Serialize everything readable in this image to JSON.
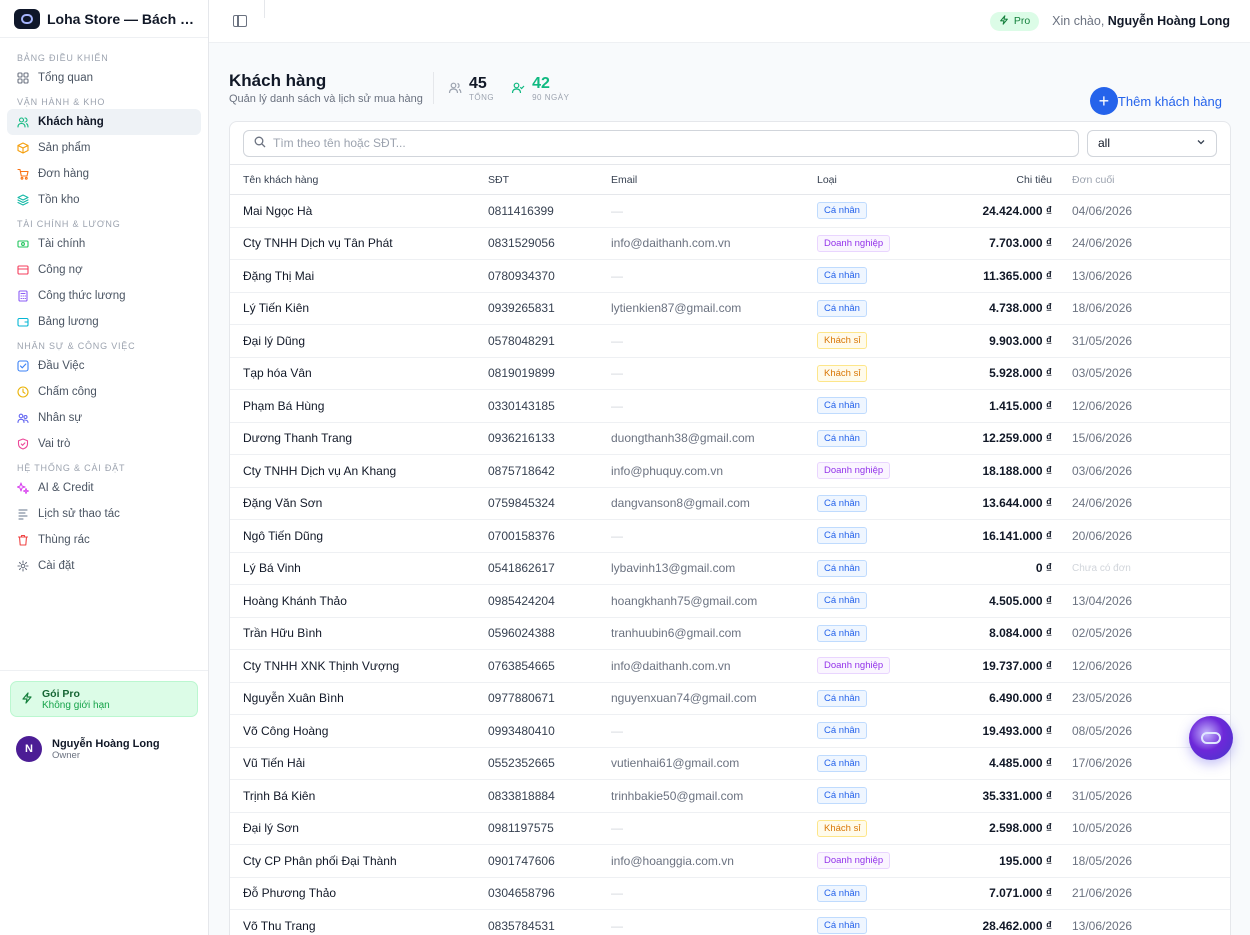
{
  "app": {
    "title": "Loha Store — Bách hóa ..."
  },
  "sidebar": {
    "groups": [
      {
        "label": "Bảng điều khiển",
        "items": [
          {
            "label": "Tổng quan",
            "icon": "grid-icon"
          }
        ]
      },
      {
        "label": "Vận hành & kho",
        "items": [
          {
            "label": "Khách hàng",
            "icon": "users-icon",
            "active": true
          },
          {
            "label": "Sản phẩm",
            "icon": "box-icon"
          },
          {
            "label": "Đơn hàng",
            "icon": "cart-icon"
          },
          {
            "label": "Tồn kho",
            "icon": "layers-icon"
          }
        ]
      },
      {
        "label": "Tài chính & lương",
        "items": [
          {
            "label": "Tài chính",
            "icon": "cash-icon"
          },
          {
            "label": "Công nợ",
            "icon": "debt-icon"
          },
          {
            "label": "Công thức lương",
            "icon": "calculator-icon"
          },
          {
            "label": "Bảng lương",
            "icon": "wallet-icon"
          }
        ]
      },
      {
        "label": "Nhân sự & công việc",
        "items": [
          {
            "label": "Đầu Việc",
            "icon": "checkbox-icon"
          },
          {
            "label": "Chấm công",
            "icon": "clock-icon"
          },
          {
            "label": "Nhân sự",
            "icon": "user-group-icon"
          },
          {
            "label": "Vai trò",
            "icon": "shield-icon"
          }
        ]
      },
      {
        "label": "Hệ thống & cài đặt",
        "items": [
          {
            "label": "AI & Credit",
            "icon": "sparkle-icon"
          },
          {
            "label": "Lịch sử thao tác",
            "icon": "history-icon"
          },
          {
            "label": "Thùng rác",
            "icon": "trash-icon"
          },
          {
            "label": "Cài đặt",
            "icon": "gear-icon"
          }
        ]
      }
    ],
    "plan": {
      "title": "Gói Pro",
      "subtitle": "Không giới hạn"
    },
    "user": {
      "initial": "N",
      "name": "Nguyễn Hoàng Long",
      "role": "Owner"
    }
  },
  "topbar": {
    "badge": "Pro",
    "greeting_prefix": "Xin chào,",
    "greeting_name": "Nguyễn Hoàng Long"
  },
  "page": {
    "title": "Khách hàng",
    "subtitle": "Quản lý danh sách và lịch sử mua hàng",
    "stats": [
      {
        "value": "45",
        "label": "Tổng"
      },
      {
        "value": "42",
        "label": "90 ngày"
      }
    ],
    "add_button": "Thêm khách hàng"
  },
  "filters": {
    "search_placeholder": "Tìm theo tên hoặc SĐT...",
    "type_select": "all"
  },
  "table": {
    "columns": [
      "Tên khách hàng",
      "SĐT",
      "Email",
      "Loại",
      "Chi tiêu",
      "Đơn cuối"
    ],
    "empty_email": "—",
    "rows": [
      {
        "name": "Mai Ngọc Hà",
        "phone": "0811416399",
        "email": "",
        "type": "Cá nhân",
        "kind": "personal",
        "spend": "24.424.000 ₫",
        "last": "04/06/2026"
      },
      {
        "name": "Cty TNHH Dịch vụ Tân Phát",
        "phone": "0831529056",
        "email": "info@daithanh.com.vn",
        "type": "Doanh nghiệp",
        "kind": "business",
        "spend": "7.703.000 ₫",
        "last": "24/06/2026"
      },
      {
        "name": "Đặng Thị Mai",
        "phone": "0780934370",
        "email": "",
        "type": "Cá nhân",
        "kind": "personal",
        "spend": "11.365.000 ₫",
        "last": "13/06/2026"
      },
      {
        "name": "Lý Tiến Kiên",
        "phone": "0939265831",
        "email": "lytienkien87@gmail.com",
        "type": "Cá nhân",
        "kind": "personal",
        "spend": "4.738.000 ₫",
        "last": "18/06/2026"
      },
      {
        "name": "Đại lý Dũng",
        "phone": "0578048291",
        "email": "",
        "type": "Khách sỉ",
        "kind": "wholesale",
        "spend": "9.903.000 ₫",
        "last": "31/05/2026"
      },
      {
        "name": "Tạp hóa Vân",
        "phone": "0819019899",
        "email": "",
        "type": "Khách sỉ",
        "kind": "wholesale",
        "spend": "5.928.000 ₫",
        "last": "03/05/2026"
      },
      {
        "name": "Phạm Bá Hùng",
        "phone": "0330143185",
        "email": "",
        "type": "Cá nhân",
        "kind": "personal",
        "spend": "1.415.000 ₫",
        "last": "12/06/2026"
      },
      {
        "name": "Dương Thanh Trang",
        "phone": "0936216133",
        "email": "duongthanh38@gmail.com",
        "type": "Cá nhân",
        "kind": "personal",
        "spend": "12.259.000 ₫",
        "last": "15/06/2026"
      },
      {
        "name": "Cty TNHH Dịch vụ An Khang",
        "phone": "0875718642",
        "email": "info@phuquy.com.vn",
        "type": "Doanh nghiệp",
        "kind": "business",
        "spend": "18.188.000 ₫",
        "last": "03/06/2026"
      },
      {
        "name": "Đặng Văn Sơn",
        "phone": "0759845324",
        "email": "dangvanson8@gmail.com",
        "type": "Cá nhân",
        "kind": "personal",
        "spend": "13.644.000 ₫",
        "last": "24/06/2026"
      },
      {
        "name": "Ngô Tiến Dũng",
        "phone": "0700158376",
        "email": "",
        "type": "Cá nhân",
        "kind": "personal",
        "spend": "16.141.000 ₫",
        "last": "20/06/2026"
      },
      {
        "name": "Lý Bá Vinh",
        "phone": "0541862617",
        "email": "lybavinh13@gmail.com",
        "type": "Cá nhân",
        "kind": "personal",
        "spend": "0 ₫",
        "last": "Chưa có đơn",
        "no_order": true
      },
      {
        "name": "Hoàng Khánh Thảo",
        "phone": "0985424204",
        "email": "hoangkhanh75@gmail.com",
        "type": "Cá nhân",
        "kind": "personal",
        "spend": "4.505.000 ₫",
        "last": "13/04/2026"
      },
      {
        "name": "Trần Hữu Bình",
        "phone": "0596024388",
        "email": "tranhuubin6@gmail.com",
        "type": "Cá nhân",
        "kind": "personal",
        "spend": "8.084.000 ₫",
        "last": "02/05/2026"
      },
      {
        "name": "Cty TNHH XNK Thịnh Vượng",
        "phone": "0763854665",
        "email": "info@daithanh.com.vn",
        "type": "Doanh nghiệp",
        "kind": "business",
        "spend": "19.737.000 ₫",
        "last": "12/06/2026"
      },
      {
        "name": "Nguyễn Xuân Bình",
        "phone": "0977880671",
        "email": "nguyenxuan74@gmail.com",
        "type": "Cá nhân",
        "kind": "personal",
        "spend": "6.490.000 ₫",
        "last": "23/05/2026"
      },
      {
        "name": "Võ Công Hoàng",
        "phone": "0993480410",
        "email": "",
        "type": "Cá nhân",
        "kind": "personal",
        "spend": "19.493.000 ₫",
        "last": "08/05/2026"
      },
      {
        "name": "Vũ Tiến Hải",
        "phone": "0552352665",
        "email": "vutienhai61@gmail.com",
        "type": "Cá nhân",
        "kind": "personal",
        "spend": "4.485.000 ₫",
        "last": "17/06/2026"
      },
      {
        "name": "Trịnh Bá Kiên",
        "phone": "0833818884",
        "email": "trinhbakie50@gmail.com",
        "type": "Cá nhân",
        "kind": "personal",
        "spend": "35.331.000 ₫",
        "last": "31/05/2026"
      },
      {
        "name": "Đại lý Sơn",
        "phone": "0981197575",
        "email": "",
        "type": "Khách sỉ",
        "kind": "wholesale",
        "spend": "2.598.000 ₫",
        "last": "10/05/2026"
      },
      {
        "name": "Cty CP Phân phối Đại Thành",
        "phone": "0901747606",
        "email": "info@hoanggia.com.vn",
        "type": "Doanh nghiệp",
        "kind": "business",
        "spend": "195.000 ₫",
        "last": "18/05/2026"
      },
      {
        "name": "Đỗ Phương Thảo",
        "phone": "0304658796",
        "email": "",
        "type": "Cá nhân",
        "kind": "personal",
        "spend": "7.071.000 ₫",
        "last": "21/06/2026"
      },
      {
        "name": "Võ Thu Trang",
        "phone": "0835784531",
        "email": "",
        "type": "Cá nhân",
        "kind": "personal",
        "spend": "28.462.000 ₫",
        "last": "13/06/2026"
      }
    ]
  },
  "colors": {
    "accent": "#2563eb",
    "pro_green": "#15803d",
    "stat_green": "#10b981",
    "personal_badge": "#2563eb",
    "business_badge": "#9333ea",
    "wholesale_badge": "#d97706"
  }
}
